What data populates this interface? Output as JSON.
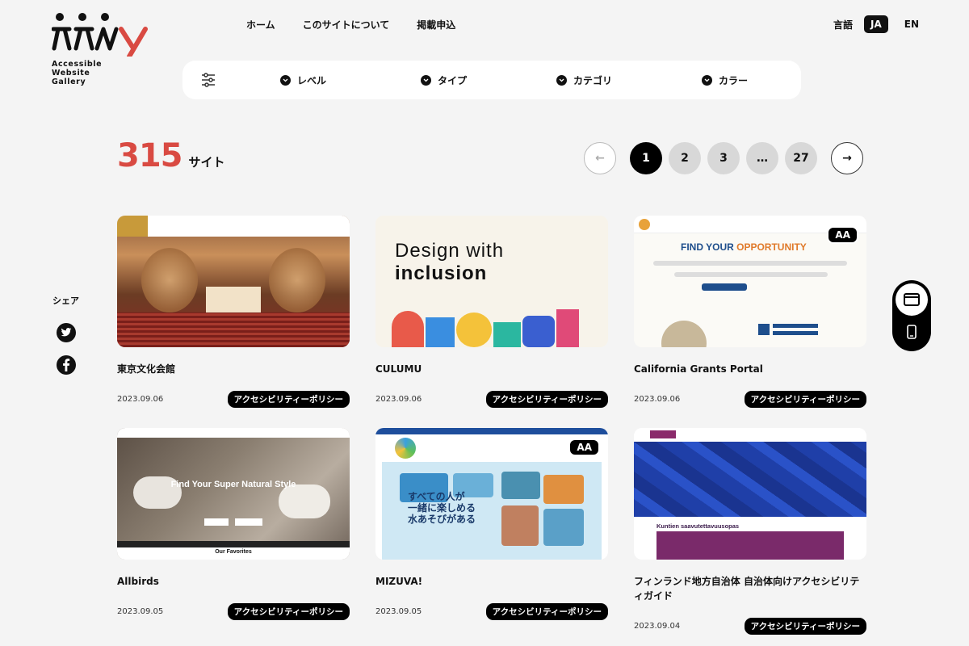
{
  "logo": {
    "line1": "Accessible",
    "line2": "Website",
    "line3": "Gallery"
  },
  "nav": {
    "home": "ホーム",
    "about": "このサイトについて",
    "apply": "掲載申込"
  },
  "lang": {
    "label": "言語",
    "ja": "JA",
    "en": "EN"
  },
  "filters": {
    "level": "レベル",
    "type": "タイプ",
    "category": "カテゴリ",
    "color": "カラー"
  },
  "count": {
    "number": "315",
    "unit": "サイト"
  },
  "pager": {
    "prev": "←",
    "pages": [
      "1",
      "2",
      "3",
      "…",
      "27"
    ],
    "next": "→"
  },
  "share": {
    "label": "シェア"
  },
  "badge_label": "アクセシビリティーポリシー",
  "aa_label": "AA",
  "cards": [
    {
      "title": "東京文化会館",
      "date": "2023.09.06"
    },
    {
      "title": "CULUMU",
      "date": "2023.09.06",
      "thumb_line1": "Design with",
      "thumb_line2": "inclusion"
    },
    {
      "title": "California Grants Portal",
      "date": "2023.09.06",
      "thumb_heading_a": "FIND YOUR ",
      "thumb_heading_b": "OPPORTUNITY"
    },
    {
      "title": "Allbirds",
      "date": "2023.09.05",
      "thumb_heading": "Find Your Super Natural Style",
      "thumb_footer": "Our Favorites"
    },
    {
      "title": "MIZUVA!",
      "date": "2023.09.05",
      "thumb_line1": "すべての人が",
      "thumb_line2": "一緒に楽しめる",
      "thumb_line3": "水あそびがある"
    },
    {
      "title": "フィンランド地方自治体 自治体向けアクセシビリティガイド",
      "date": "2023.09.04",
      "thumb_heading": "Kuntien saavutettavuusopas"
    }
  ],
  "colors": {
    "accent": "#d94a42",
    "dark": "#111111"
  }
}
